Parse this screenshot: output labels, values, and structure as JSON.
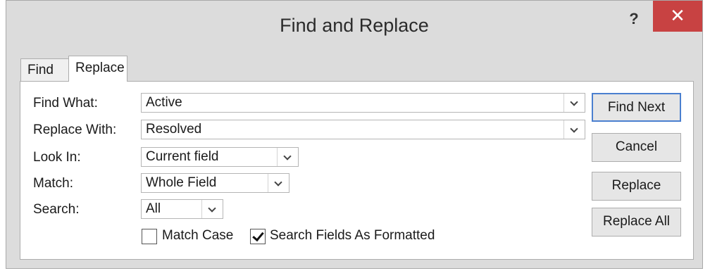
{
  "window": {
    "title": "Find and Replace",
    "help_label": "?",
    "close_label": "✕"
  },
  "tabs": [
    {
      "label": "Find",
      "active": false
    },
    {
      "label": "Replace",
      "active": true
    }
  ],
  "form": {
    "find_what": {
      "label": "Find What:",
      "value": "Active"
    },
    "replace_with": {
      "label": "Replace With:",
      "value": "Resolved"
    },
    "look_in": {
      "label": "Look In:",
      "value": "Current field"
    },
    "match": {
      "label": "Match:",
      "value": "Whole Field"
    },
    "search": {
      "label": "Search:",
      "value": "All"
    },
    "match_case": {
      "label": "Match Case",
      "checked": false
    },
    "search_formatted": {
      "label": "Search Fields As Formatted",
      "checked": true
    }
  },
  "buttons": {
    "find_next": "Find Next",
    "cancel": "Cancel",
    "replace": "Replace",
    "replace_all": "Replace All"
  },
  "icons": {
    "dropdown": "chevron-down-icon",
    "close": "close-icon",
    "help": "help-icon",
    "check": "checkmark-icon"
  },
  "colors": {
    "close_button": "#c84242",
    "default_button_border": "#4a7fcf",
    "window_frame": "#dcdcdc"
  }
}
